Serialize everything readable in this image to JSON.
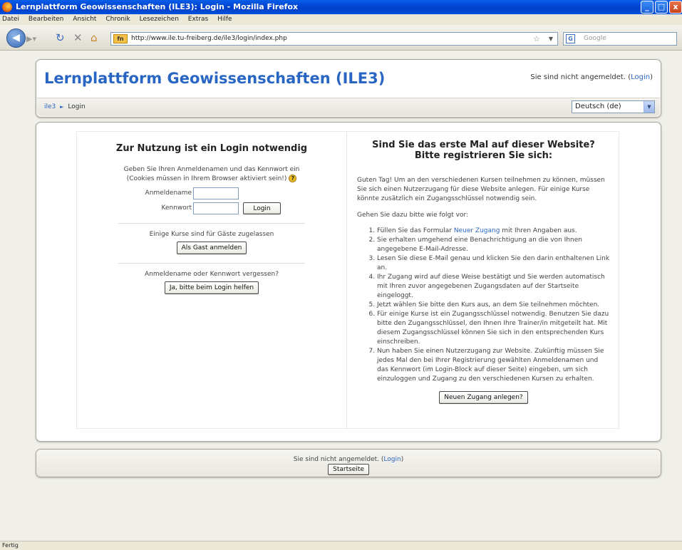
{
  "window": {
    "title": "Lernplattform Geowissenschaften (ILE3): Login - Mozilla Firefox",
    "min": "_",
    "max": "□",
    "close": "x"
  },
  "menu": [
    "Datei",
    "Bearbeiten",
    "Ansicht",
    "Chronik",
    "Lesezeichen",
    "Extras",
    "Hilfe"
  ],
  "nav": {
    "url": "http://www.ile.tu-freiberg.de/ile3/login/index.php",
    "site_icon": "fn",
    "search_placeholder": "Google"
  },
  "header": {
    "site_title": "Lernplattform Geowissenschaften (ILE3)",
    "login_status_prefix": "Sie sind nicht angemeldet. (",
    "login_link": "Login",
    "login_status_suffix": ")",
    "breadcrumb_home": "ile3",
    "breadcrumb_sep": "►",
    "breadcrumb_current": "Login",
    "language": "Deutsch (de)"
  },
  "login": {
    "heading": "Zur Nutzung ist ein Login notwendig",
    "desc_line1": "Geben Sie Ihren Anmeldenamen und das Kennwort ein",
    "desc_line2": "(Cookies müssen in Ihrem Browser aktiviert sein!)",
    "username_label": "Anmeldename",
    "password_label": "Kennwort",
    "username_value": "",
    "password_value": "",
    "login_button": "Login",
    "guest_text": "Einige Kurse sind für Gäste zugelassen",
    "guest_button": "Als Gast anmelden",
    "forgot_text": "Anmeldename oder Kennwort vergessen?",
    "forgot_button": "Ja, bitte beim Login helfen"
  },
  "register": {
    "heading_line1": "Sind Sie das erste Mal auf dieser Website?",
    "heading_line2": "Bitte registrieren Sie sich:",
    "intro": "Guten Tag! Um an den verschiedenen Kursen teilnehmen zu können, müssen Sie sich einen Nutzerzugang für diese Website anlegen. Für einige Kurse könnte zusätzlich ein Zugangsschlüssel notwendig sein.",
    "intro2": "Gehen Sie dazu bitte wie folgt vor:",
    "step1_prefix": "Füllen Sie das Formular ",
    "step1_link": "Neuer Zugang",
    "step1_suffix": " mit Ihren Angaben aus.",
    "steps": [
      "Sie erhalten umgehend eine Benachrichtigung an die von Ihnen angegebene E-Mail-Adresse.",
      "Lesen Sie diese E-Mail genau und klicken Sie den darin enthaltenen Link an.",
      "Ihr Zugang wird auf diese Weise bestätigt und Sie werden automatisch mit Ihren zuvor angegebenen Zugangsdaten auf der Startseite eingeloggt.",
      "Jetzt wählen Sie bitte den Kurs aus, an dem Sie teilnehmen möchten.",
      "Für einige Kurse ist ein Zugangsschlüssel notwendig. Benutzen Sie dazu bitte den Zugangsschlüssel, den Ihnen Ihre Trainer/in mitgeteilt hat. Mit diesem Zugangsschlüssel können Sie sich in den entsprechenden Kurs einschreiben.",
      "Nun haben Sie einen Nutzerzugang zur Website. Zukünftig müssen Sie jedes Mal den bei Ihrer Registrierung gewählten Anmeldenamen und das Kennwort (im Login-Block auf dieser Seite) eingeben, um sich einzuloggen und Zugang zu den verschiedenen Kursen zu erhalten."
    ],
    "button": "Neuen Zugang anlegen?"
  },
  "footer": {
    "status_prefix": "Sie sind nicht angemeldet. (",
    "login_link": "Login",
    "status_suffix": ")",
    "home_button": "Startseite"
  },
  "status": "Fertig"
}
